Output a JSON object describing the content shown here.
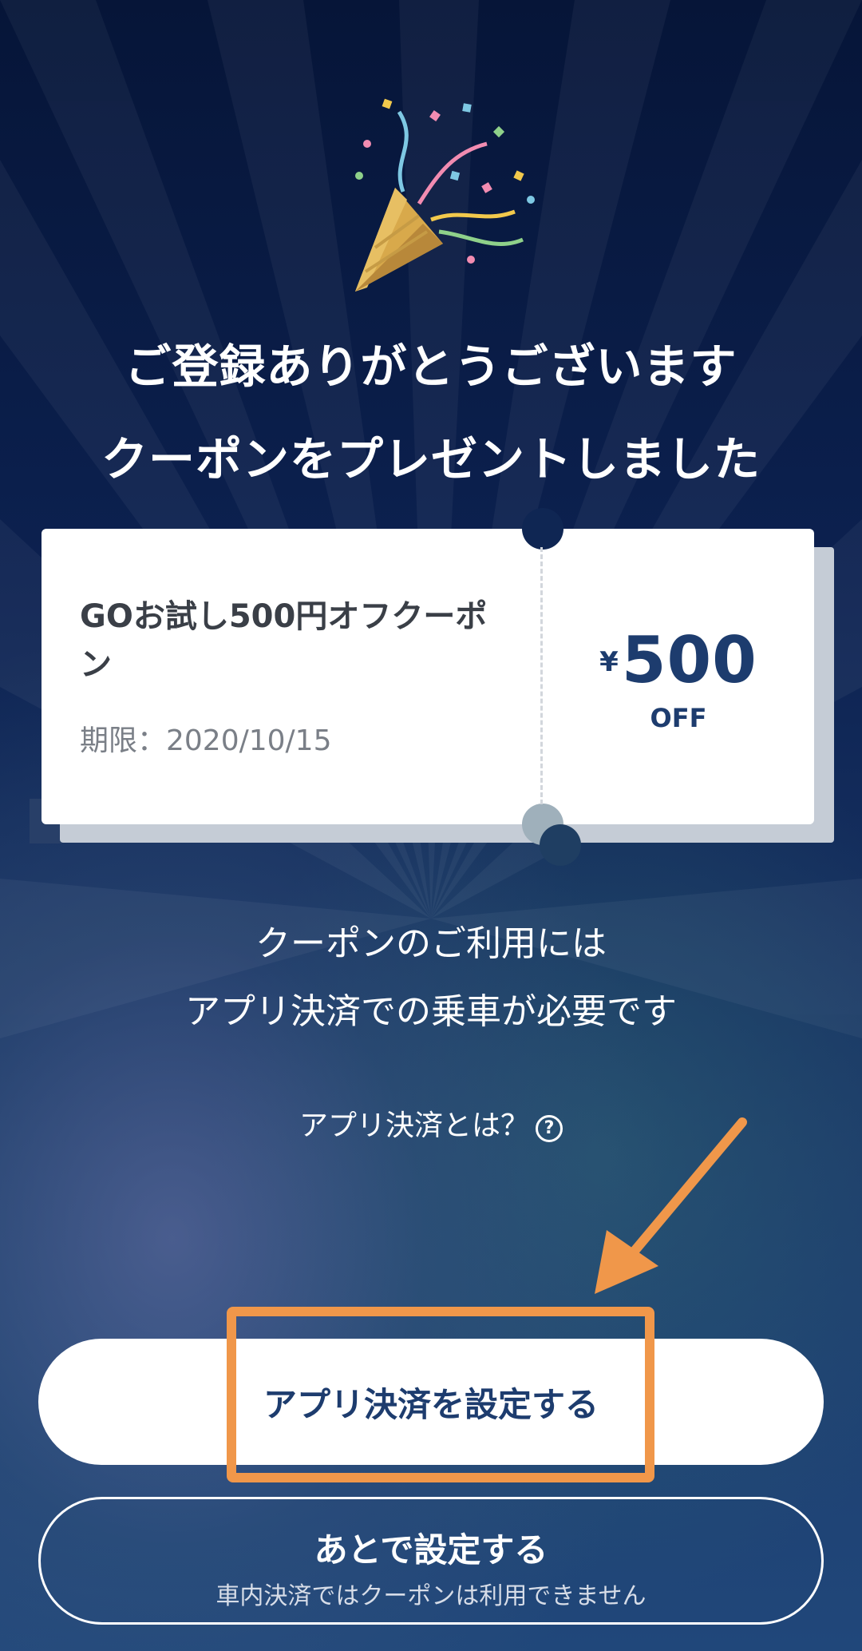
{
  "header": {
    "line1": "ご登録ありがとうございます",
    "line2": "クーポンをプレゼントしました"
  },
  "coupon": {
    "title": "GOお試し500円オフクーポン",
    "expiry": "期限：2020/10/15",
    "currency_symbol": "¥",
    "amount": "500",
    "off_label": "OFF"
  },
  "info": {
    "line1": "クーポンのご利用には",
    "line2": "アプリ決済での乗車が必要です",
    "help_link": "アプリ決済とは？",
    "help_icon": "question-circle-icon"
  },
  "buttons": {
    "primary_label": "アプリ決済を設定する",
    "secondary_label": "あとで設定する",
    "secondary_sublabel": "車内決済ではクーポンは利用できません"
  },
  "annotation": {
    "color": "#f0974a"
  },
  "colors": {
    "accent": "#1d3c6e",
    "background": "#0c2150"
  }
}
